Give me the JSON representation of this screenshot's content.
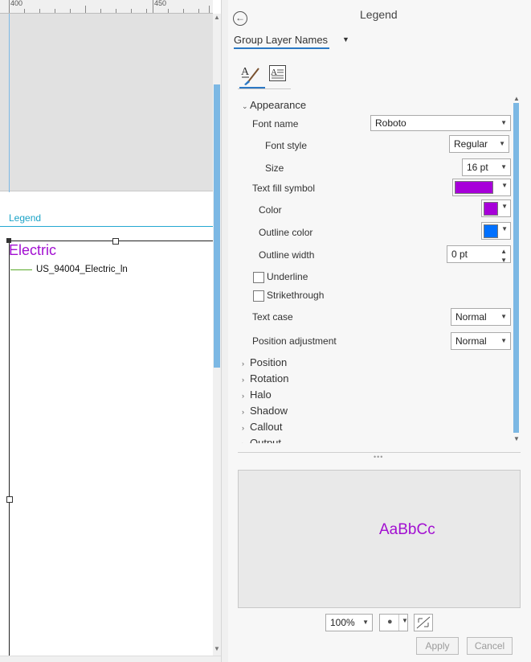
{
  "ruler": {
    "labels": [
      "400",
      "450"
    ]
  },
  "layout": {
    "legend_title": "Legend",
    "group_name": "Electric",
    "layer_name": "US_94004_Electric_ln"
  },
  "pane": {
    "title": "Legend",
    "tab": "Group Layer Names",
    "tabs": [
      {
        "label": "text-symbol-icon"
      },
      {
        "label": "text-frame-icon"
      }
    ]
  },
  "appearance": {
    "section_label": "Appearance",
    "font_name_label": "Font name",
    "font_name_value": "Roboto",
    "font_style_label": "Font style",
    "font_style_value": "Regular",
    "size_label": "Size",
    "size_value": "16 pt",
    "text_fill_label": "Text fill symbol",
    "color_label": "Color",
    "outline_color_label": "Outline color",
    "outline_width_label": "Outline width",
    "outline_width_value": "0 pt",
    "underline_label": "Underline",
    "strikethrough_label": "Strikethrough",
    "text_case_label": "Text case",
    "text_case_value": "Normal",
    "position_adjustment_label": "Position adjustment",
    "position_adjustment_value": "Normal"
  },
  "sections": [
    "Position",
    "Rotation",
    "Halo",
    "Shadow",
    "Callout",
    "Output"
  ],
  "preview": {
    "text": "AaBbCc"
  },
  "footer": {
    "zoom": "100%",
    "apply": "Apply",
    "cancel": "Cancel"
  },
  "colors": {
    "text_fill": "#a700d9",
    "color": "#a700d9",
    "outline_color": "#0070ff",
    "accent": "#2b78c4",
    "guide": "#7cb8e4"
  }
}
